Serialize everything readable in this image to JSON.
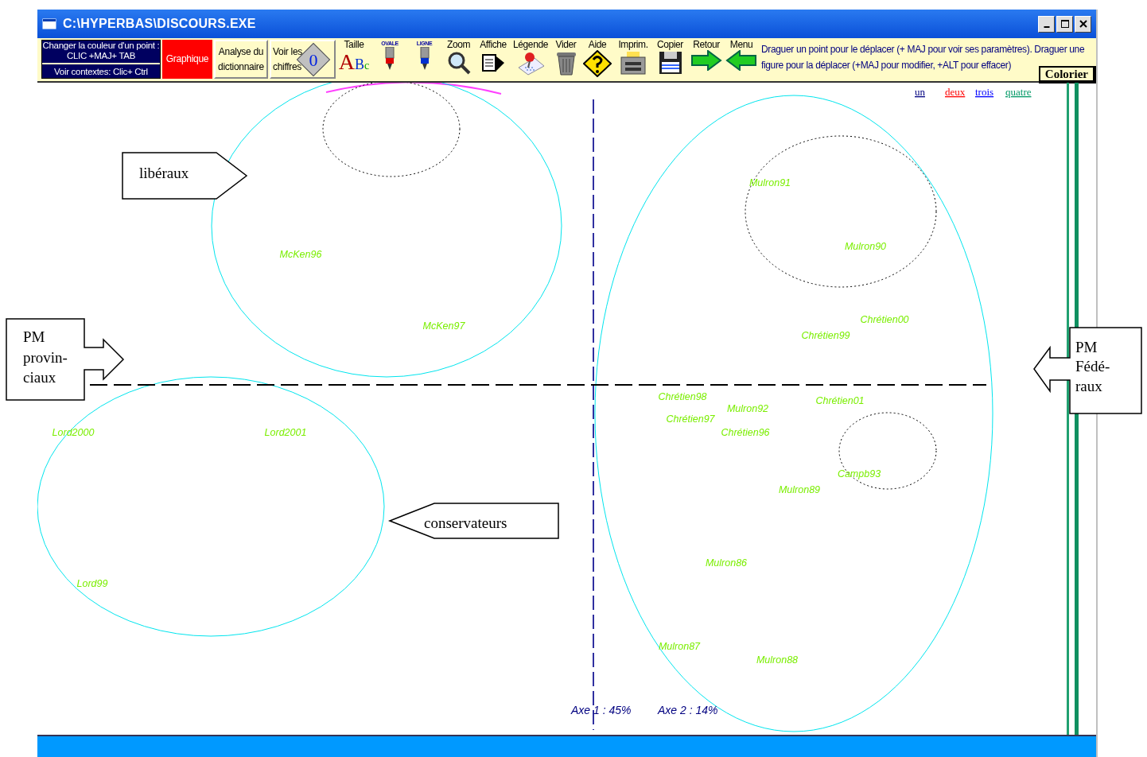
{
  "window": {
    "title": "C:\\HYPERBAS\\DISCOURS.EXE"
  },
  "hints": [
    "Changer la couleur d'un point : CLIC +MAJ+ TAB",
    "Voir contextes: Clic+ Ctrl"
  ],
  "toolbar": [
    {
      "label": "Graphique",
      "kind": "text",
      "selected": true
    },
    {
      "label": "Analyse du dictionnaire",
      "kind": "text",
      "selected": false
    },
    {
      "label": "Voir les chiffres",
      "kind": "digit",
      "digit": "0",
      "selected": false
    },
    {
      "label": "Taille",
      "kind": "letters",
      "letters": "ABc",
      "selected": false
    },
    {
      "label": "OVALE",
      "kind": "tiny",
      "selected": false
    },
    {
      "label": "LIGNE",
      "kind": "tiny",
      "selected": false
    },
    {
      "label": "Zoom",
      "kind": "tool",
      "selected": false
    },
    {
      "label": "Affiche",
      "kind": "tool",
      "selected": false
    },
    {
      "label": "Légende",
      "kind": "tool",
      "selected": false
    },
    {
      "label": "Vider",
      "kind": "tool",
      "selected": false
    },
    {
      "label": "Aide",
      "kind": "tool",
      "selected": false
    },
    {
      "label": "Imprim.",
      "kind": "tool",
      "selected": false
    },
    {
      "label": "Copier",
      "kind": "tool",
      "selected": false
    },
    {
      "label": "Retour",
      "kind": "tool",
      "selected": false
    },
    {
      "label": "Menu",
      "kind": "tool",
      "selected": false
    }
  ],
  "instructions": "Draguer un point pour le déplacer (+ MAJ  pour voir ses paramètres). Draguer une figure pour la déplacer (+MAJ pour modifier, +ALT pour effacer)",
  "colorier_button": "Colorier",
  "legend": [
    {
      "label": "un",
      "color": "#000080"
    },
    {
      "label": "deux",
      "color": "#ff0000"
    },
    {
      "label": "trois",
      "color": "#0000ff"
    },
    {
      "label": "quatre",
      "color": "#009966"
    }
  ],
  "points": [
    "Mulron91",
    "McKen96",
    "Mulron90",
    "McKen97",
    "Chrétien00",
    "Chrétien99",
    "Chrétien98",
    "Chrétien01",
    "Mulron92",
    "Chrétien97",
    "Lord2000",
    "Lord2001",
    "Chrétien96",
    "Campb93",
    "Mulron89",
    "Mulron86",
    "Lord99",
    "Mulron87",
    "Mulron88"
  ],
  "axes": [
    "Axe 1 :  45%",
    "Axe 2 :  14%"
  ],
  "callouts": [
    {
      "kind": "right",
      "lines": [
        "libéraux"
      ]
    },
    {
      "kind": "box-right",
      "lines": [
        "PM",
        "provin-",
        "ciaux"
      ]
    },
    {
      "kind": "left",
      "lines": [
        "conservateurs"
      ]
    },
    {
      "kind": "box-left",
      "lines": [
        "PM",
        "Fédé-",
        "raux"
      ]
    }
  ]
}
